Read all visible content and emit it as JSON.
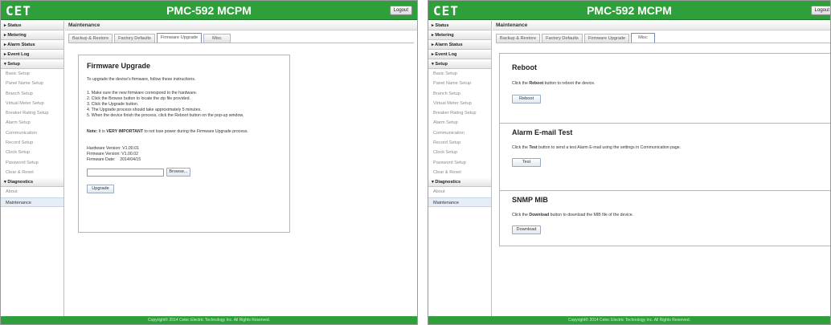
{
  "app": {
    "logo": "CET",
    "title": "PMC-592 MCPM",
    "logout_label": "Logout",
    "footer": "Copyright© 2014 Celec Electric Technology Inc. All Rights Reserved."
  },
  "sidebar": {
    "groups": [
      {
        "label": "▸ Status"
      },
      {
        "label": "▸ Metering"
      },
      {
        "label": "▸ Alarm Status"
      },
      {
        "label": "▸ Event Log"
      },
      {
        "label": "▾ Setup"
      },
      {
        "label": "▾ Diagnostics"
      }
    ],
    "setup_items": [
      "Basic Setup",
      "Panel Name Setup",
      "Branch Setup",
      "Virtual Meter Setup",
      "Breaker Rating Setup",
      "Alarm Setup",
      "Communication",
      "Record Setup",
      "Clock Setup",
      "Password Setup",
      "Clear & Reset"
    ],
    "diagnostics_items": [
      "About",
      "Maintenance"
    ]
  },
  "main": {
    "section_title": "Maintenance",
    "tabs": [
      "Backup & Restore",
      "Factory Defaults",
      "Firmware Upgrade",
      "Misc"
    ]
  },
  "firmware": {
    "title": "Firmware Upgrade",
    "intro": "To upgrade the device's firmware, follow these instructions.",
    "steps": [
      "1.  Make sure the new firmware correspond to the hardware.",
      "2.  Click the Browse button to locate the zip file provided.",
      "3.  Click the Upgrade button.",
      "4.  The Upgrade process should take approximately 5 minutes.",
      "5.  When the device finish the process, click the Reboot button on the pop-up window."
    ],
    "note_prefix": "Note:",
    "note_mid": " It is ",
    "note_emph": "VERY IMPORTANT",
    "note_suffix": " to not lose power during the Firmware Upgrade process.",
    "hardware_version": "Hardware Version: V1.00.01",
    "firmware_version": "Firmware Version: V1.00.02",
    "firmware_date": "Firmware Date:    2014/04/15",
    "browse_label": "Browse...",
    "upgrade_label": "Upgrade"
  },
  "misc": {
    "reboot_title": "Reboot",
    "reboot_desc_pre": "Click the ",
    "reboot_desc_bold": "Reboot",
    "reboot_desc_post": " button to reboot the device.",
    "reboot_label": "Reboot",
    "email_title": "Alarm E-mail Test",
    "email_desc_pre": "Click the ",
    "email_desc_bold": "Test",
    "email_desc_post": " button to send a test Alarm E-mail using the settings in Communication page.",
    "test_label": "Test",
    "snmp_title": "SNMP MIB",
    "snmp_desc_pre": "Click the ",
    "snmp_desc_bold": "Download",
    "snmp_desc_post": " button to download the MIB file of the device.",
    "download_label": "Download"
  },
  "colors": {
    "header_green": "#2e9f3a",
    "active_tab_border": "#7a8fb0"
  }
}
